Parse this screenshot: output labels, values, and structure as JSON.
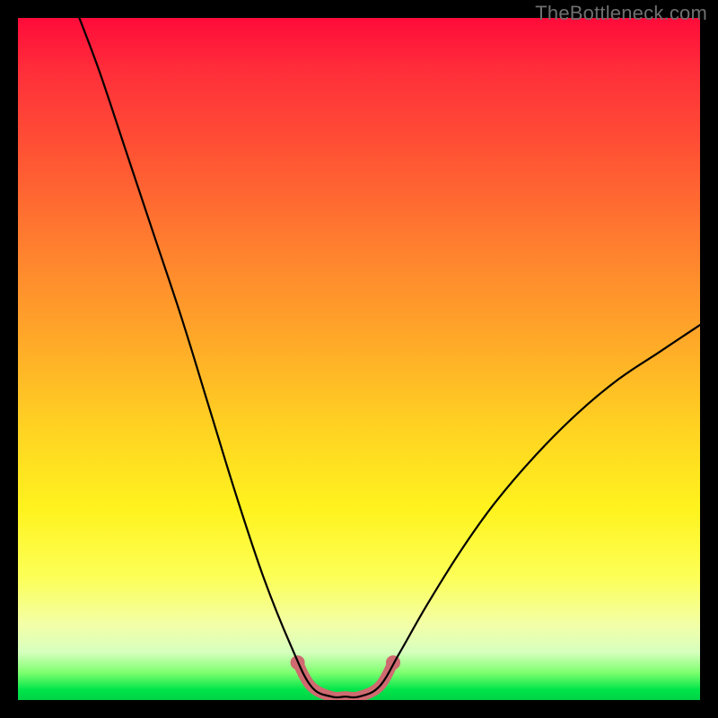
{
  "watermark": "TheBottleneck.com",
  "chart_data": {
    "type": "line",
    "title": "",
    "xlabel": "",
    "ylabel": "",
    "xlim": [
      0,
      100
    ],
    "ylim": [
      0,
      100
    ],
    "grid": false,
    "series": [
      {
        "name": "black-curve",
        "color": "#000000",
        "width": 2.2,
        "points": [
          {
            "x": 9,
            "y": 100
          },
          {
            "x": 12,
            "y": 92
          },
          {
            "x": 16,
            "y": 80
          },
          {
            "x": 20,
            "y": 68
          },
          {
            "x": 24,
            "y": 56
          },
          {
            "x": 28,
            "y": 43
          },
          {
            "x": 32,
            "y": 30
          },
          {
            "x": 36,
            "y": 18
          },
          {
            "x": 40,
            "y": 8
          },
          {
            "x": 43,
            "y": 2
          },
          {
            "x": 46,
            "y": 0.5
          },
          {
            "x": 48,
            "y": 0.5
          },
          {
            "x": 50,
            "y": 0.5
          },
          {
            "x": 53,
            "y": 2
          },
          {
            "x": 56,
            "y": 7
          },
          {
            "x": 60,
            "y": 14
          },
          {
            "x": 65,
            "y": 22
          },
          {
            "x": 70,
            "y": 29
          },
          {
            "x": 76,
            "y": 36
          },
          {
            "x": 82,
            "y": 42
          },
          {
            "x": 88,
            "y": 47
          },
          {
            "x": 94,
            "y": 51
          },
          {
            "x": 100,
            "y": 55
          }
        ]
      },
      {
        "name": "pink-highlight",
        "color": "#cf6a70",
        "width": 12,
        "linecap": "round",
        "points": [
          {
            "x": 41,
            "y": 5.5
          },
          {
            "x": 43,
            "y": 2
          },
          {
            "x": 46,
            "y": 0.5
          },
          {
            "x": 48,
            "y": 0.5
          },
          {
            "x": 50,
            "y": 0.5
          },
          {
            "x": 53,
            "y": 2
          },
          {
            "x": 55,
            "y": 5.5
          }
        ]
      },
      {
        "name": "pink-end-dot-left",
        "color": "#cf6a70",
        "type_hint": "marker",
        "points": [
          {
            "x": 41,
            "y": 5.5
          }
        ],
        "radius": 8
      },
      {
        "name": "pink-end-dot-right",
        "color": "#cf6a70",
        "type_hint": "marker",
        "points": [
          {
            "x": 55,
            "y": 5.5
          }
        ],
        "radius": 8
      }
    ],
    "annotations": [
      {
        "text": "TheBottleneck.com",
        "pos": "top-right",
        "color": "#6f6f6f"
      }
    ]
  }
}
